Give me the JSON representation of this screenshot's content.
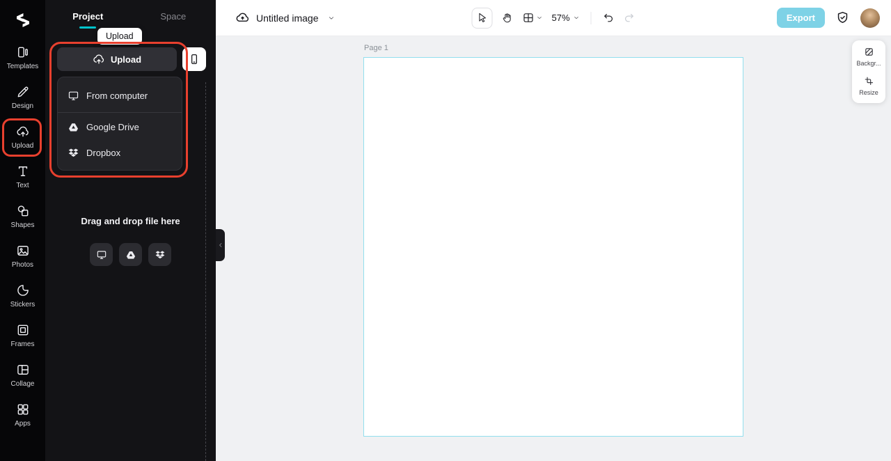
{
  "colors": {
    "accent": "#00c4cc",
    "annotation": "#e8402e",
    "export_button_bg": "#7ed2e6",
    "canvas_border": "#92dfee"
  },
  "rail": {
    "logo_icon": "capcut-logo",
    "items": [
      {
        "label": "Templates",
        "icon": "templates-icon"
      },
      {
        "label": "Design",
        "icon": "design-icon"
      },
      {
        "label": "Upload",
        "icon": "upload-icon",
        "annotated": true
      },
      {
        "label": "Text",
        "icon": "text-icon"
      },
      {
        "label": "Shapes",
        "icon": "shapes-icon"
      },
      {
        "label": "Photos",
        "icon": "photos-icon"
      },
      {
        "label": "Stickers",
        "icon": "stickers-icon"
      },
      {
        "label": "Frames",
        "icon": "frames-icon"
      },
      {
        "label": "Collage",
        "icon": "collage-icon"
      },
      {
        "label": "Apps",
        "icon": "apps-icon"
      }
    ]
  },
  "panel": {
    "tabs": [
      {
        "label": "Project",
        "active": true
      },
      {
        "label": "Space",
        "active": false
      }
    ],
    "tooltip": "Upload",
    "upload_menu": {
      "button_label": "Upload",
      "phone_button_icon": "phone-icon",
      "items": [
        {
          "label": "From computer",
          "icon": "computer-icon"
        },
        {
          "label": "Google Drive",
          "icon": "google-drive-icon"
        },
        {
          "label": "Dropbox",
          "icon": "dropbox-icon"
        }
      ]
    },
    "dropzone": {
      "text": "Drag and drop file here",
      "buttons": [
        {
          "icon": "computer-icon"
        },
        {
          "icon": "google-drive-icon"
        },
        {
          "icon": "dropbox-icon"
        }
      ]
    }
  },
  "topbar": {
    "cloud_icon": "cloud-upload-icon",
    "title": "Untitled image",
    "tools": [
      {
        "name": "select",
        "icon": "cursor-icon",
        "active": true
      },
      {
        "name": "hand",
        "icon": "hand-icon"
      },
      {
        "name": "layout",
        "icon": "grid-icon"
      },
      {
        "name": "zoom",
        "value": "57%"
      },
      {
        "name": "undo",
        "icon": "undo-icon"
      },
      {
        "name": "redo",
        "icon": "redo-icon",
        "disabled": true
      }
    ],
    "zoom": "57%",
    "export_label": "Export",
    "shield_icon": "shield-check-icon"
  },
  "canvas": {
    "page_label": "Page 1"
  },
  "inspector": {
    "background_label": "Backgr...",
    "background_icon": "background-icon",
    "resize_label": "Resize",
    "resize_icon": "resize-icon"
  }
}
